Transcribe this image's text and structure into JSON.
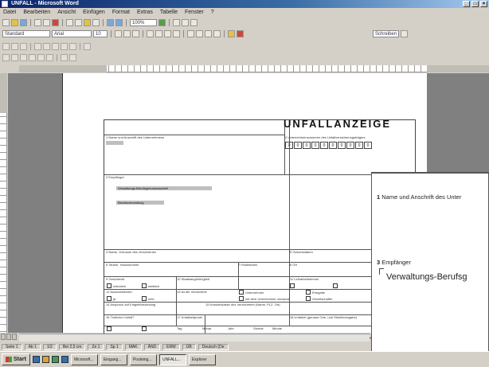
{
  "window": {
    "title": "UNFALL - Microsoft Word",
    "buttons": [
      "_",
      "□",
      "×"
    ]
  },
  "menubar": [
    "Datei",
    "Bearbeiten",
    "Ansicht",
    "Einfügen",
    "Format",
    "Extras",
    "Tabelle",
    "Fenster",
    "?"
  ],
  "toolbar": {
    "style_combo": "Standard",
    "font_combo": "Arial",
    "size_combo": "10",
    "zoom_combo": "100%",
    "font_name_right": "Schreiben"
  },
  "document": {
    "form_title": "UNFALLANZEIGE",
    "field1_label": "1 Name und Anschrift des Unternehmens",
    "field2_label": "2 Unternehmensnummer des Unfallversicherungsträgers",
    "field3_label": "3 Empfänger",
    "recipient_line1": "Verwaltungs-Berufsgenossenschaft",
    "recipient_line2": "Bezirksverwaltung",
    "field4_label": "4 Name, Vorname des Versicherten",
    "field5_label": "5 Geburtsdatum",
    "field6_label": "6 Straße, Hausnummer",
    "field7_label": "7 Postleitzahl",
    "field8_label": "8 Ort",
    "field9_label": "9 Geschlecht",
    "field10_label": "10 Staatsangehörigkeit",
    "field11_label": "11 Leiharbeitnehmer",
    "field12_label": "12 Auszubildender",
    "field13_label": "13 Ist der Versicherte",
    "field14_label": "14 Anspruch auf Entgeltfortzahlung",
    "field15_label": "15 Krankenkasse des Versicherten (Name, PLZ, Ort)",
    "field16_label": "16 Tödlicher Unfall?",
    "field17_label": "17 Unfallzeitpunkt",
    "field18_label": "18 Unfallort (genaue Orts- und Straßenangabe)",
    "digits": [
      "0",
      "0",
      "0",
      "0",
      "0",
      "0",
      "0",
      "0",
      "0",
      "0"
    ],
    "cb_labels": [
      "männlich",
      "weiblich",
      "ja",
      "nein",
      "Unternehmer",
      "mit dem Unternehmer verwandt",
      "Ehegatte",
      "Gesellschafter"
    ],
    "date_labels": [
      "Tag",
      "Monat",
      "Jahr",
      "Stunde",
      "Minute"
    ]
  },
  "zoom_view": {
    "field1_num": "1",
    "field1_text": "Name und Anschrift des Unter",
    "field3_num": "3",
    "field3_text": "Empfänger",
    "recipient": "Verwaltungs-Berufsg"
  },
  "statusbar": {
    "page": "Seite 1",
    "section": "Ab 1",
    "pages": "1/2",
    "position": "Bei 2,5 cm",
    "line": "Ze 1",
    "col": "Sp 1",
    "modes": [
      "MAK",
      "ÄND",
      "ERW",
      "ÜB"
    ],
    "language": "Deutsch (De"
  },
  "taskbar": {
    "start": "Start",
    "tasks": [
      "Microsoft...",
      "Eingang...",
      "Posteing...",
      "UNFALL...",
      "Explorer"
    ]
  }
}
